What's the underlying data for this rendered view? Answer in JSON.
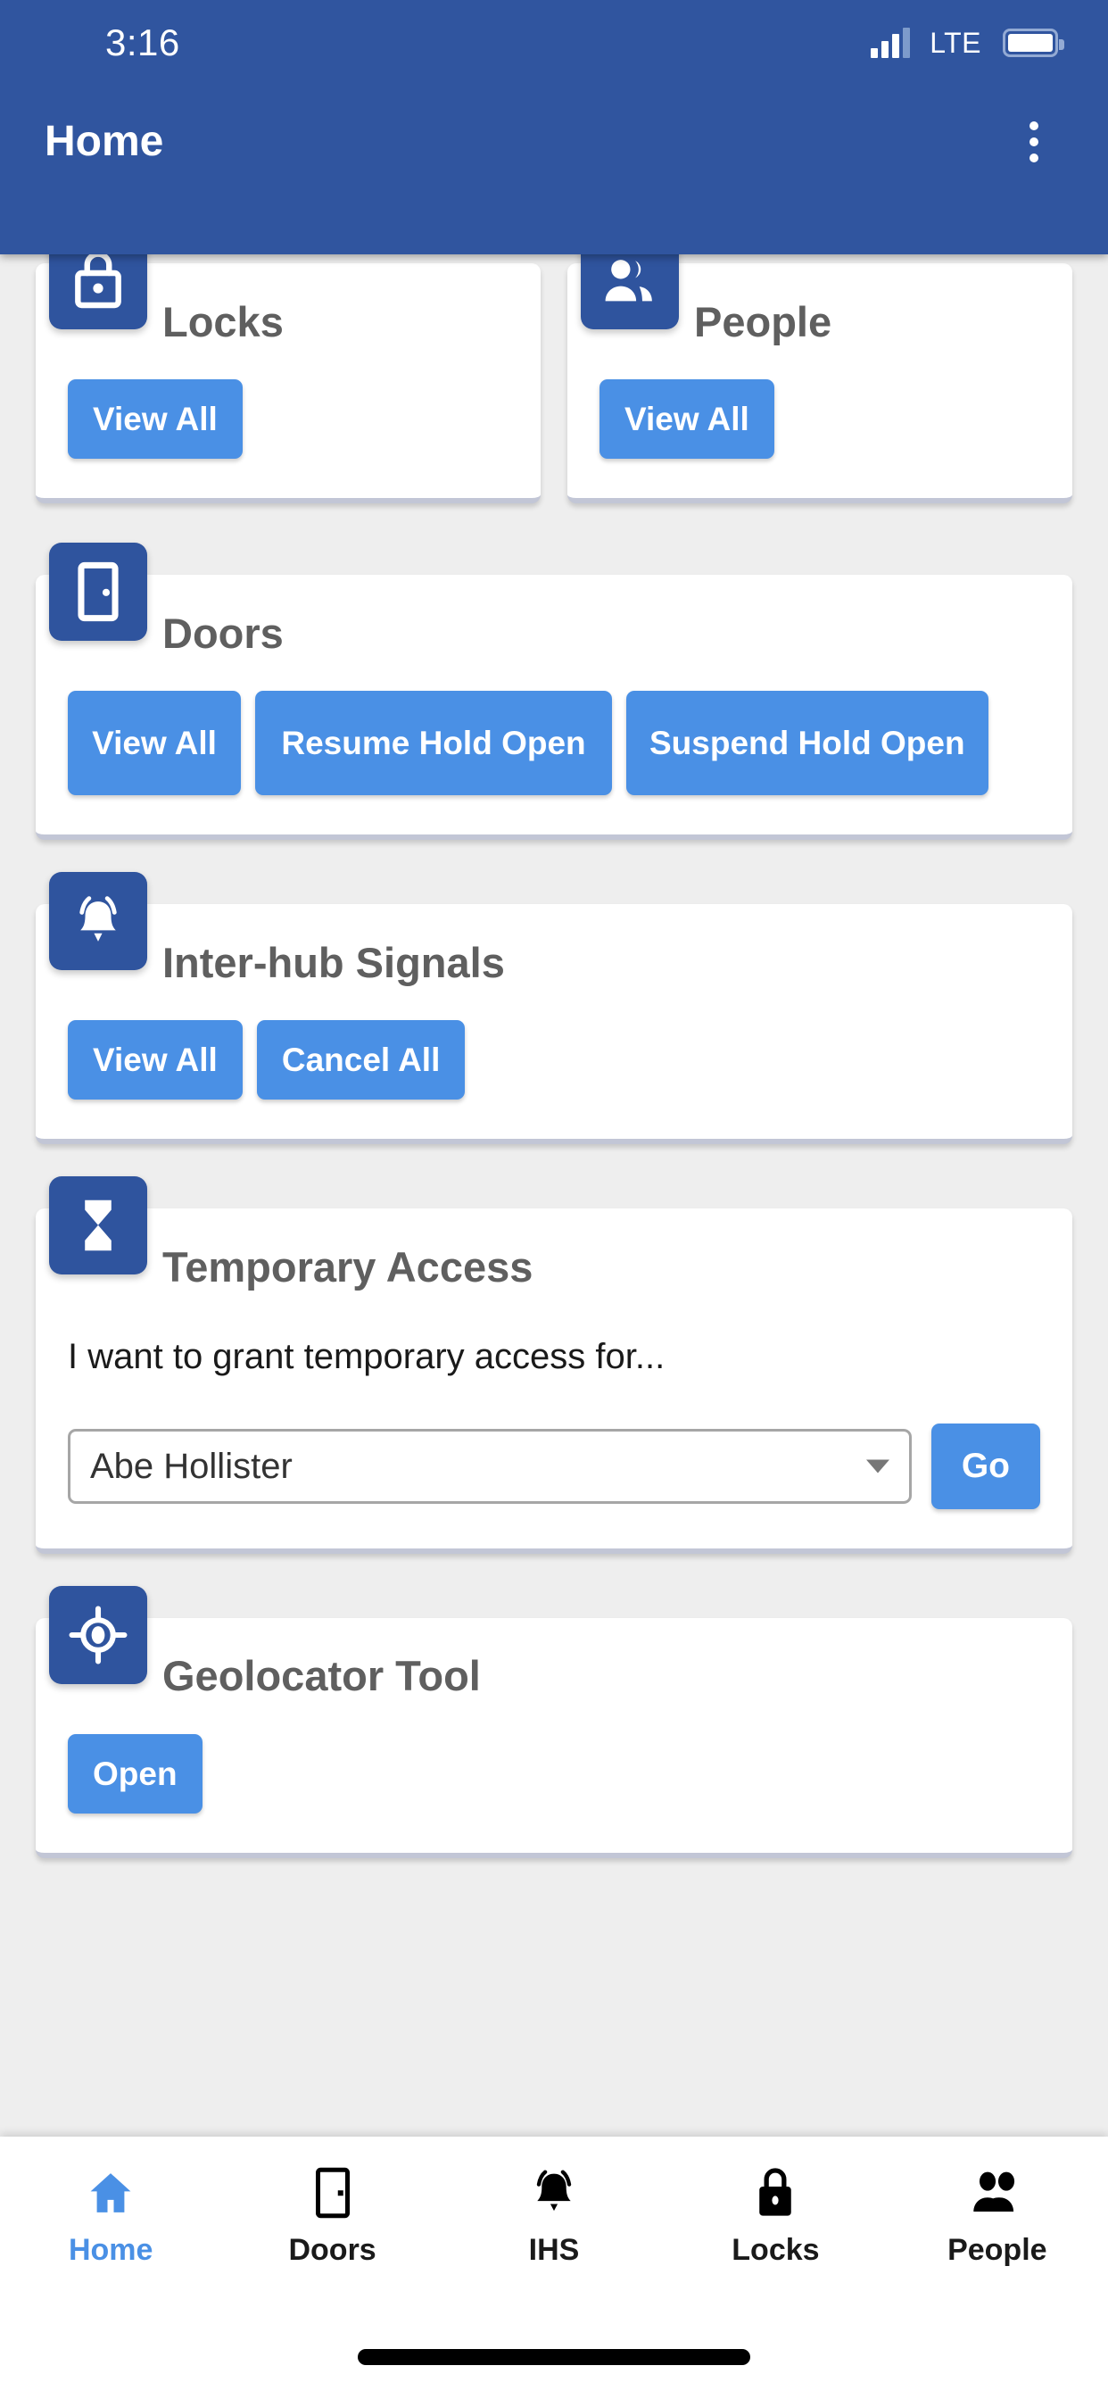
{
  "status_bar": {
    "time": "3:16",
    "network": "LTE",
    "signal_icon": "signal-bars-icon",
    "battery_icon": "battery-full-icon"
  },
  "header": {
    "title": "Home",
    "overflow_icon": "kebab-menu-icon"
  },
  "theme": {
    "header_blue": "#30559f",
    "icon_tile_blue": "#2f549e",
    "button_blue": "#4a90e5",
    "page_background": "#eeeeee",
    "card_background": "#ffffff",
    "card_title_color": "#5f5f5f",
    "nav_active_color": "#4a90e5"
  },
  "cards": [
    {
      "id": "locks",
      "title": "Locks",
      "icon": "lock-icon",
      "buttons": [
        {
          "label": "View All",
          "name": "locks-view-all-button"
        }
      ]
    },
    {
      "id": "people",
      "title": "People",
      "icon": "people-icon",
      "buttons": [
        {
          "label": "View All",
          "name": "people-view-all-button"
        }
      ]
    },
    {
      "id": "doors",
      "title": "Doors",
      "icon": "door-icon",
      "buttons": [
        {
          "label": "View All",
          "name": "doors-view-all-button"
        },
        {
          "label": "Resume Hold Open",
          "name": "doors-resume-hold-open-button"
        },
        {
          "label": "Suspend Hold Open",
          "name": "doors-suspend-hold-open-button"
        }
      ]
    },
    {
      "id": "interhub_signals",
      "title": "Inter-hub Signals",
      "icon": "bell-ringing-icon",
      "buttons": [
        {
          "label": "View All",
          "name": "ihs-view-all-button"
        },
        {
          "label": "Cancel All",
          "name": "ihs-cancel-all-button"
        }
      ]
    },
    {
      "id": "temporary_access",
      "title": "Temporary Access",
      "icon": "hourglass-icon",
      "prompt": "I want to grant temporary access for...",
      "select_value": "Abe Hollister",
      "go_label": "Go"
    },
    {
      "id": "geolocator_tool",
      "title": "Geolocator Tool",
      "icon": "crosshair-location-icon",
      "buttons": [
        {
          "label": "Open",
          "name": "geolocator-open-button"
        }
      ]
    }
  ],
  "bottom_nav": {
    "items": [
      {
        "label": "Home",
        "icon": "home-icon",
        "active": true
      },
      {
        "label": "Doors",
        "icon": "door-icon",
        "active": false
      },
      {
        "label": "IHS",
        "icon": "bell-icon",
        "active": false
      },
      {
        "label": "Locks",
        "icon": "lock-icon",
        "active": false
      },
      {
        "label": "People",
        "icon": "people-icon",
        "active": false
      }
    ]
  }
}
